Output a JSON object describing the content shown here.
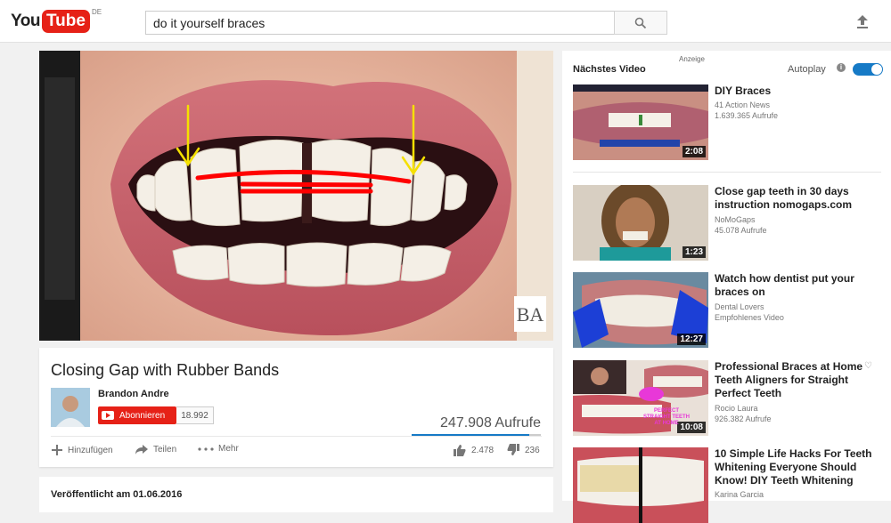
{
  "header": {
    "logo_you": "You",
    "logo_tube": "Tube",
    "logo_country": "DE",
    "search_value": "do it yourself braces"
  },
  "video": {
    "title": "Closing Gap with Rubber Bands",
    "watermark": "BA",
    "channel": "Brandon Andre",
    "subscribe_label": "Abonnieren",
    "subscriber_count": "18.992",
    "views": "247.908 Aufrufe",
    "like_ratio": 0.91,
    "actions": {
      "add": "Hinzufügen",
      "share": "Teilen",
      "more": "Mehr",
      "likes": "2.478",
      "dislikes": "236"
    },
    "published": "Veröffentlicht am 01.06.2016"
  },
  "sidebar": {
    "ad_label": "Anzeige",
    "next_label": "Nächstes Video",
    "autoplay_label": "Autoplay",
    "autoplay_on": true,
    "items": [
      {
        "title": "DIY Braces",
        "channel": "41 Action News",
        "views": "1.639.365 Aufrufe",
        "duration": "2:08"
      },
      {
        "title": "Close gap teeth in 30 days instruction nomogaps.com",
        "channel": "NoMoGaps",
        "views": "45.078 Aufrufe",
        "duration": "1:23"
      },
      {
        "title": "Watch how dentist put your braces on",
        "channel": "Dental Lovers",
        "views": "Empfohlenes Video",
        "duration": "12:27"
      },
      {
        "title": "Professional Braces at Home Teeth Aligners for Straight Perfect Teeth",
        "channel": "Rocio Laura",
        "views": "926.382 Aufrufe",
        "duration": "10:08",
        "thumb_text": "PERFECT STRAIGHT TEETH AT HOME"
      },
      {
        "title": "10 Simple Life Hacks For Teeth Whitening Everyone Should Know! DIY Teeth Whitening",
        "channel": "Karina Garcia",
        "views": "",
        "duration": ""
      }
    ]
  },
  "colors": {
    "brand_red": "#e62117",
    "accent_blue": "#167ac6",
    "annotation_red": "#ff0000",
    "annotation_yellow": "#f5e000"
  }
}
